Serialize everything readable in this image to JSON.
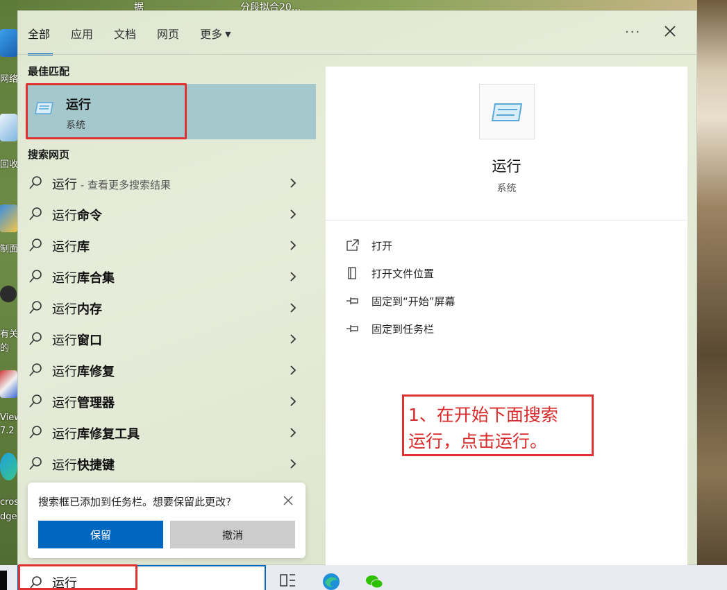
{
  "desktop": {
    "top_texts": [
      "据",
      "分段拟合20..."
    ],
    "left_labels": [
      "网络",
      "回收站",
      "制面",
      "有关",
      "的",
      "View",
      "7.2",
      "cros",
      "dge"
    ]
  },
  "panel": {
    "tabs": [
      {
        "label": "全部"
      },
      {
        "label": "应用"
      },
      {
        "label": "文档"
      },
      {
        "label": "网页"
      },
      {
        "label": "更多"
      }
    ],
    "more_glyph": "···",
    "best_match_title": "最佳匹配",
    "best_match": {
      "title": "运行",
      "subtitle": "系统"
    },
    "web_section_title": "搜索网页",
    "results": [
      {
        "prefix": "运行",
        "bold": "",
        "sub": " - 查看更多搜索结果"
      },
      {
        "prefix": "运行",
        "bold": "命令",
        "sub": ""
      },
      {
        "prefix": "运行",
        "bold": "库",
        "sub": ""
      },
      {
        "prefix": "运行",
        "bold": "库合集",
        "sub": ""
      },
      {
        "prefix": "运行",
        "bold": "内存",
        "sub": ""
      },
      {
        "prefix": "运行",
        "bold": "窗口",
        "sub": ""
      },
      {
        "prefix": "运行",
        "bold": "库修复",
        "sub": ""
      },
      {
        "prefix": "运行",
        "bold": "管理器",
        "sub": ""
      },
      {
        "prefix": "运行",
        "bold": "库修复工具",
        "sub": ""
      },
      {
        "prefix": "运行",
        "bold": "快捷键",
        "sub": ""
      }
    ]
  },
  "detail": {
    "title": "运行",
    "subtitle": "系统",
    "actions": [
      {
        "label": "打开",
        "icon": "open-icon"
      },
      {
        "label": "打开文件位置",
        "icon": "file-location-icon"
      },
      {
        "label": "固定到“开始”屏幕",
        "icon": "pin-icon"
      },
      {
        "label": "固定到任务栏",
        "icon": "pin-icon"
      }
    ],
    "annotation_line1": "1、在开始下面搜索",
    "annotation_line2": "运行，点击运行。"
  },
  "toast": {
    "message": "搜索框已添加到任务栏。想要保留此更改?",
    "keep_label": "保留",
    "cancel_label": "撤消"
  },
  "taskbar": {
    "search_value": "运行"
  },
  "colors": {
    "accent": "#0067c0",
    "highlight": "#a4c8cc",
    "annotation_red": "#e03030"
  }
}
